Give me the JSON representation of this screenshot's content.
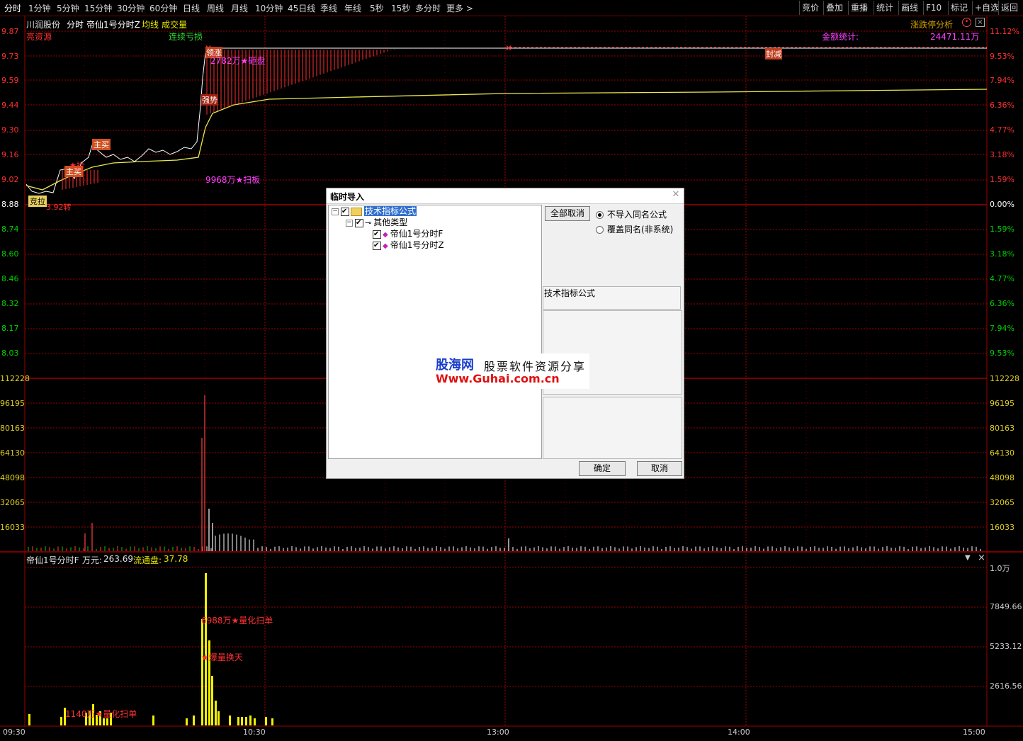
{
  "toolbar": {
    "periods": [
      "分时",
      "1分钟",
      "5分钟",
      "15分钟",
      "30分钟",
      "60分钟",
      "日线",
      "周线",
      "月线",
      "10分钟",
      "45日线",
      "季线",
      "年线",
      "5秒",
      "15秒",
      "多分时",
      "更多 >"
    ],
    "right_buttons": [
      "竞价",
      "叠加",
      "重播",
      "统计",
      "画线",
      "F10",
      "标记",
      "+自选",
      "返回"
    ]
  },
  "header": {
    "stock": "川润股份",
    "mode": "分时",
    "indicator": "帝仙1号分时Z",
    "avg": "均线",
    "vol": "成交量",
    "right_label": "涨跌停分析"
  },
  "price_axis": {
    "left": [
      "9.87",
      "9.73",
      "9.59",
      "9.44",
      "9.30",
      "9.16",
      "9.02",
      "8.88",
      "8.74",
      "8.60",
      "8.46",
      "8.32",
      "8.17",
      "8.03"
    ],
    "right": [
      "11.12%",
      "9.53%",
      "7.94%",
      "6.36%",
      "4.77%",
      "3.18%",
      "1.59%",
      "0.00%",
      "1.59%",
      "3.18%",
      "4.77%",
      "6.36%",
      "7.94%",
      "9.53%"
    ]
  },
  "volume_axis": [
    "112228",
    "96195",
    "80163",
    "64130",
    "48098",
    "32065",
    "16033"
  ],
  "indicator_axis": [
    "1.0万",
    "7849.66",
    "5233.12",
    "2616.56"
  ],
  "time_axis": [
    "09:30",
    "10:30",
    "13:00",
    "14:00",
    "15:00"
  ],
  "annotations": {
    "top_left": "亮资源",
    "cont": "连续亏损",
    "amount_label": "金额统计:",
    "amount_value": "24471.11万",
    "volume_tag": "领涨",
    "main_buy1": "主买",
    "main_buy2": "主买",
    "auction": "竞拉",
    "auction_val": "3.92转",
    "star1": "★抬",
    "big1": "2782万★砸盘",
    "strong": "强势",
    "sweep": "9968万★扫板",
    "seal": "封减"
  },
  "indicator_header": {
    "name": "帝仙1号分时F",
    "unit_label": "万元:",
    "unit_value": "263.69",
    "float_label": "流通盘:",
    "float_value": "37.78",
    "ann1": "6988万★量化扫单",
    "ann2": "★爆量换天",
    "ann3": "1140万★量化扫单"
  },
  "dialog": {
    "title": "临时导入",
    "tree": {
      "root": "技术指标公式",
      "group": "其他类型",
      "items": [
        "帝仙1号分时F",
        "帝仙1号分时Z"
      ]
    },
    "cancel_all": "全部取消",
    "radio1": "不导入同名公式",
    "radio2": "覆盖同名(非系统)",
    "desc_title": "技术指标公式",
    "ok": "确定",
    "cancel": "取消"
  },
  "watermark": {
    "brand": "股海网",
    "slogan": "股票软件资源分享",
    "url": "Www.Guhai.com.cn"
  },
  "colors": {
    "grid": "#8b0000",
    "price_line": "#ffffff",
    "avg_line": "#e8e850",
    "up": "#ff3030",
    "down": "#00d000"
  }
}
